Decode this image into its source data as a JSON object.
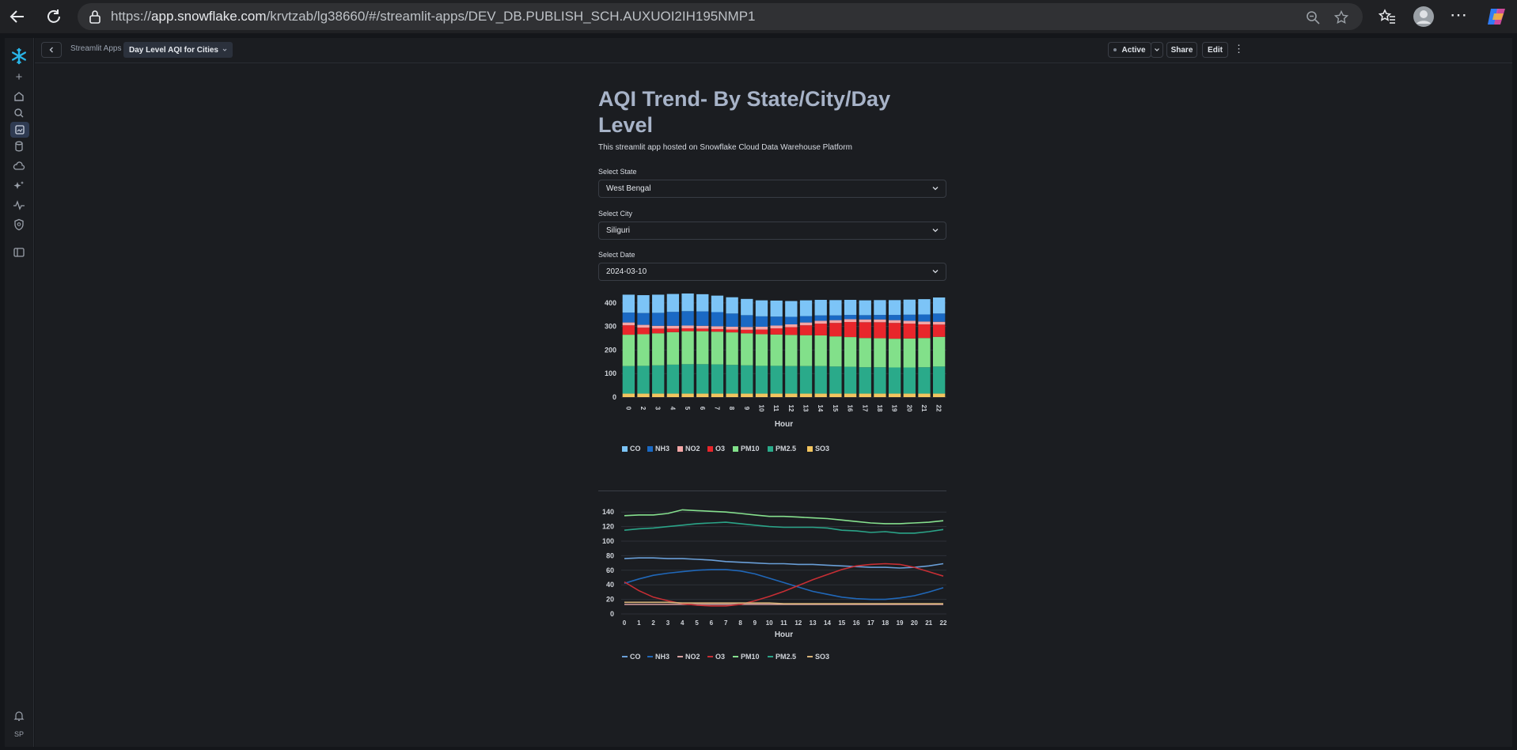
{
  "browser": {
    "url_prefix": "https://",
    "url_host": "app.snowflake.com",
    "url_path": "/krvtzab/lg38660/#/streamlit-apps/DEV_DB.PUBLISH_SCH.AUXUOI2IH195NMP1"
  },
  "topbar": {
    "breadcrumb_parent": "Streamlit Apps",
    "breadcrumb_current": "Day Level AQI for Cities",
    "status_label": "Active",
    "share_label": "Share",
    "edit_label": "Edit"
  },
  "rail": {
    "user_initials": "SP"
  },
  "app": {
    "title": "AQI Trend- By State/City/Day Level",
    "subtitle": "This streamlit app hosted on Snowflake Cloud Data Warehouse Platform",
    "state_label": "Select State",
    "state_value": "West Bengal",
    "city_label": "Select City",
    "city_value": "Siliguri",
    "date_label": "Select Date",
    "date_value": "2024-03-10"
  },
  "colors": {
    "CO": "#7cc4f7",
    "NH3": "#1a69c4",
    "NO2": "#f4a6a6",
    "O3": "#e8262b",
    "PM10": "#82e08a",
    "PM2.5": "#2aaa8a",
    "SO3": "#f2c45f"
  },
  "chart_data": [
    {
      "type": "bar",
      "stacked": true,
      "xlabel": "Hour",
      "ylabel": "",
      "ylim": [
        0,
        450
      ],
      "yticks": [
        0,
        100,
        200,
        300,
        400
      ],
      "categories": [
        "0",
        "2",
        "3",
        "4",
        "5",
        "6",
        "7",
        "8",
        "9",
        "10",
        "11",
        "12",
        "13",
        "14",
        "15",
        "16",
        "17",
        "18",
        "19",
        "20",
        "21",
        "22"
      ],
      "legend_position": "bottom",
      "series": [
        {
          "name": "SO3",
          "values": [
            15,
            15,
            15,
            15,
            15,
            15,
            15,
            15,
            15,
            15,
            15,
            15,
            15,
            15,
            15,
            15,
            15,
            15,
            15,
            15,
            15,
            15
          ]
        },
        {
          "name": "PM2.5",
          "values": [
            117,
            118,
            120,
            123,
            125,
            125,
            124,
            122,
            120,
            118,
            118,
            117,
            117,
            117,
            115,
            114,
            112,
            112,
            111,
            111,
            112,
            115
          ]
        },
        {
          "name": "PM10",
          "values": [
            133,
            134,
            136,
            138,
            140,
            140,
            139,
            138,
            136,
            134,
            133,
            132,
            131,
            130,
            128,
            126,
            124,
            123,
            122,
            123,
            124,
            126
          ]
        },
        {
          "name": "O3",
          "values": [
            40,
            28,
            20,
            15,
            12,
            11,
            11,
            12,
            15,
            20,
            26,
            33,
            42,
            50,
            57,
            64,
            67,
            68,
            67,
            63,
            58,
            52
          ]
        },
        {
          "name": "NO2",
          "values": [
            12,
            12,
            12,
            12,
            12,
            12,
            12,
            12,
            12,
            12,
            12,
            12,
            12,
            12,
            12,
            12,
            12,
            12,
            12,
            12,
            12,
            12
          ]
        },
        {
          "name": "NH3",
          "values": [
            42,
            50,
            55,
            59,
            61,
            61,
            60,
            56,
            50,
            44,
            38,
            32,
            27,
            23,
            20,
            18,
            18,
            19,
            22,
            26,
            30,
            35
          ]
        },
        {
          "name": "CO",
          "values": [
            76,
            76,
            77,
            76,
            75,
            73,
            70,
            69,
            69,
            68,
            68,
            67,
            67,
            66,
            65,
            64,
            63,
            63,
            63,
            64,
            65,
            68
          ]
        }
      ]
    },
    {
      "type": "line",
      "xlabel": "Hour",
      "ylabel": "",
      "ylim": [
        0,
        150
      ],
      "yticks": [
        0,
        20,
        40,
        60,
        80,
        100,
        120,
        140
      ],
      "x": [
        0,
        1,
        2,
        3,
        4,
        5,
        6,
        7,
        8,
        9,
        10,
        11,
        12,
        13,
        14,
        15,
        16,
        17,
        18,
        19,
        20,
        21,
        22
      ],
      "legend_position": "bottom",
      "series": [
        {
          "name": "CO",
          "values": [
            76,
            77,
            77,
            76,
            76,
            75,
            74,
            72,
            71,
            70,
            69,
            69,
            68,
            68,
            67,
            66,
            65,
            64,
            64,
            63,
            64,
            66,
            69
          ]
        },
        {
          "name": "NH3",
          "values": [
            42,
            48,
            53,
            56,
            58,
            60,
            61,
            61,
            59,
            55,
            49,
            43,
            37,
            31,
            27,
            23,
            21,
            20,
            20,
            22,
            25,
            30,
            36
          ]
        },
        {
          "name": "NO2",
          "values": [
            13,
            13,
            13,
            13,
            13,
            13,
            13,
            13,
            13,
            13,
            13,
            13,
            13,
            13,
            13,
            13,
            13,
            13,
            13,
            13,
            13,
            13,
            13
          ]
        },
        {
          "name": "O3",
          "values": [
            44,
            32,
            23,
            18,
            14,
            12,
            11,
            11,
            13,
            18,
            24,
            31,
            39,
            47,
            54,
            61,
            66,
            68,
            69,
            68,
            64,
            58,
            52
          ]
        },
        {
          "name": "PM10",
          "values": [
            135,
            136,
            136,
            138,
            143,
            142,
            141,
            140,
            138,
            136,
            134,
            134,
            133,
            132,
            131,
            129,
            127,
            125,
            124,
            124,
            125,
            126,
            128
          ]
        },
        {
          "name": "PM2.5",
          "values": [
            115,
            117,
            118,
            120,
            122,
            124,
            125,
            126,
            124,
            122,
            120,
            119,
            119,
            119,
            118,
            115,
            114,
            112,
            113,
            111,
            111,
            113,
            116
          ]
        },
        {
          "name": "SO3",
          "values": [
            16,
            16,
            16,
            16,
            15,
            15,
            15,
            15,
            15,
            15,
            15,
            14,
            14,
            14,
            14,
            14,
            14,
            14,
            14,
            14,
            14,
            14,
            14
          ]
        }
      ]
    }
  ]
}
